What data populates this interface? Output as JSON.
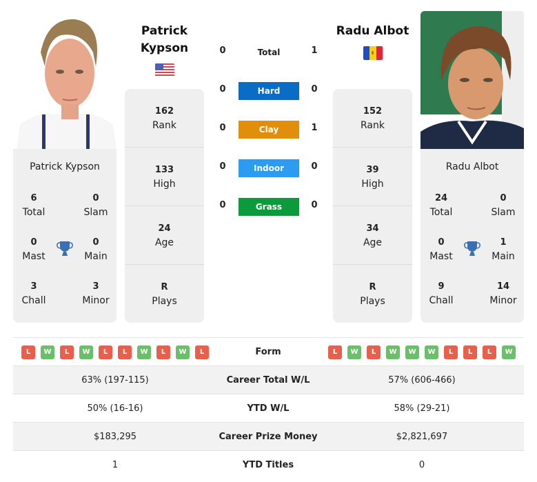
{
  "players": {
    "left": {
      "name": "Patrick Kypson",
      "name_line1": "Patrick",
      "name_line2": "Kypson",
      "flag": "us-flag",
      "stats": [
        {
          "value": "162",
          "label": "Rank"
        },
        {
          "value": "133",
          "label": "High"
        },
        {
          "value": "24",
          "label": "Age"
        },
        {
          "value": "R",
          "label": "Plays"
        }
      ],
      "titles": {
        "total": {
          "value": "6",
          "label": "Total"
        },
        "slam": {
          "value": "0",
          "label": "Slam"
        },
        "mast": {
          "value": "0",
          "label": "Mast"
        },
        "main": {
          "value": "0",
          "label": "Main"
        },
        "chall": {
          "value": "3",
          "label": "Chall"
        },
        "minor": {
          "value": "3",
          "label": "Minor"
        }
      },
      "form": [
        "L",
        "W",
        "L",
        "W",
        "L",
        "L",
        "W",
        "L",
        "W",
        "L"
      ]
    },
    "right": {
      "name": "Radu Albot",
      "flag": "moldova-flag",
      "stats": [
        {
          "value": "152",
          "label": "Rank"
        },
        {
          "value": "39",
          "label": "High"
        },
        {
          "value": "34",
          "label": "Age"
        },
        {
          "value": "R",
          "label": "Plays"
        }
      ],
      "titles": {
        "total": {
          "value": "24",
          "label": "Total"
        },
        "slam": {
          "value": "0",
          "label": "Slam"
        },
        "mast": {
          "value": "0",
          "label": "Mast"
        },
        "main": {
          "value": "1",
          "label": "Main"
        },
        "chall": {
          "value": "9",
          "label": "Chall"
        },
        "minor": {
          "value": "14",
          "label": "Minor"
        }
      },
      "form": [
        "L",
        "W",
        "L",
        "W",
        "W",
        "W",
        "L",
        "L",
        "L",
        "W"
      ]
    }
  },
  "h2h": [
    {
      "label": "Total",
      "left": "0",
      "right": "1",
      "color": ""
    },
    {
      "label": "Hard",
      "left": "0",
      "right": "0",
      "color": "#0a6cc4"
    },
    {
      "label": "Clay",
      "left": "0",
      "right": "1",
      "color": "#e08e0b"
    },
    {
      "label": "Indoor",
      "left": "0",
      "right": "0",
      "color": "#2b9cf2"
    },
    {
      "label": "Grass",
      "left": "0",
      "right": "0",
      "color": "#0b9a3c"
    }
  ],
  "comparison": {
    "form_label": "Form",
    "rows": [
      {
        "label": "Career Total W/L",
        "left": "63% (197-115)",
        "right": "57% (606-466)"
      },
      {
        "label": "YTD W/L",
        "left": "50% (16-16)",
        "right": "58% (29-21)"
      },
      {
        "label": "Career Prize Money",
        "left": "$183,295",
        "right": "$2,821,697"
      },
      {
        "label": "YTD Titles",
        "left": "1",
        "right": "0"
      }
    ]
  },
  "colors": {
    "loss": "#e8604c",
    "win": "#6bbf6b",
    "trophy": "#3a6fb5",
    "card_bg": "#efefef"
  }
}
